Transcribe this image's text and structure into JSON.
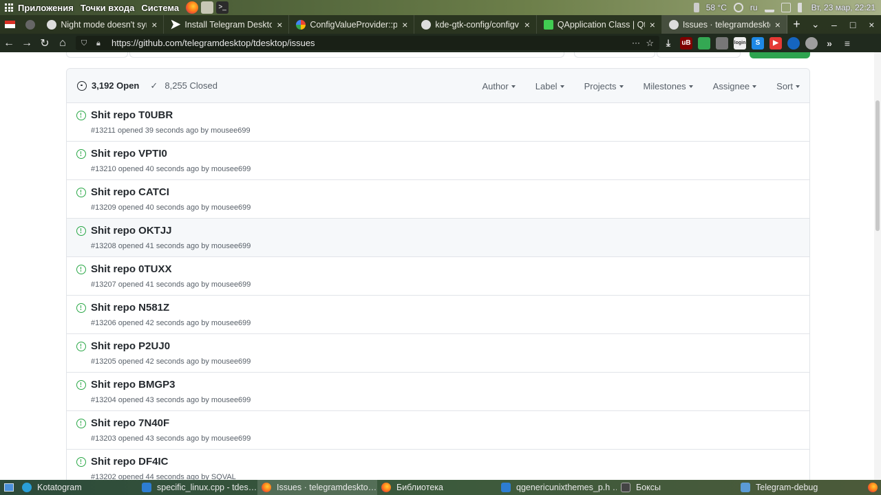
{
  "system_panel": {
    "menus": [
      "Приложения",
      "Точки входа",
      "Система"
    ],
    "temperature": "58 °C",
    "keyboard_layout": "ru",
    "clock": "Вт, 23 мар, 22:21"
  },
  "browser": {
    "tabs": [
      {
        "title": "Night mode doesn't syn",
        "icon": "github-icon"
      },
      {
        "title": "Install Telegram Deskto",
        "icon": "telegram-icon"
      },
      {
        "title": "ConfigValueProvider::p",
        "icon": "google-icon"
      },
      {
        "title": "kde-gtk-config/configv",
        "icon": "github-icon"
      },
      {
        "title": "QApplication Class | Qt",
        "icon": "qt-icon"
      },
      {
        "title": "Issues · telegramdeskto",
        "icon": "github-icon",
        "active": true
      }
    ],
    "new_tab": "+",
    "url": "https://github.com/telegramdesktop/tdesktop/issues",
    "more_actions": "···",
    "extensions": [
      {
        "name": "ublock-icon",
        "badge": "4"
      },
      {
        "name": "sheets-icon",
        "badge": "2"
      },
      {
        "name": "mask-icon",
        "badge": ""
      },
      {
        "name": "login-icon",
        "badge": "login"
      },
      {
        "name": "s-icon",
        "badge": ""
      },
      {
        "name": "youtube-icon",
        "badge": ""
      },
      {
        "name": "clock-icon",
        "badge": ""
      },
      {
        "name": "circle-icon",
        "badge": ""
      }
    ]
  },
  "issues": {
    "open_count": "3,192 Open",
    "closed_count": "8,255 Closed",
    "filters": [
      "Author",
      "Label",
      "Projects",
      "Milestones",
      "Assignee",
      "Sort"
    ],
    "items": [
      {
        "title": "Shit repo T0UBR",
        "meta": "#13211 opened 39 seconds ago by mousee699"
      },
      {
        "title": "Shit repo VPTI0",
        "meta": "#13210 opened 40 seconds ago by mousee699"
      },
      {
        "title": "Shit repo CATCI",
        "meta": "#13209 opened 40 seconds ago by mousee699"
      },
      {
        "title": "Shit repo OKTJJ",
        "meta": "#13208 opened 41 seconds ago by mousee699"
      },
      {
        "title": "Shit repo 0TUXX",
        "meta": "#13207 opened 41 seconds ago by mousee699"
      },
      {
        "title": "Shit repo N581Z",
        "meta": "#13206 opened 42 seconds ago by mousee699"
      },
      {
        "title": "Shit repo P2UJ0",
        "meta": "#13205 opened 42 seconds ago by mousee699"
      },
      {
        "title": "Shit repo BMGP3",
        "meta": "#13204 opened 43 seconds ago by mousee699"
      },
      {
        "title": "Shit repo 7N40F",
        "meta": "#13203 opened 43 seconds ago by mousee699"
      },
      {
        "title": "Shit repo DF4IC",
        "meta": "#13202 opened 44 seconds ago by SQVAL"
      }
    ]
  },
  "taskbar": {
    "tasks": [
      {
        "label": "Kotatogram",
        "icon": "telegram-icon"
      },
      {
        "label": "specific_linux.cpp - tdes…",
        "icon": "vscode-icon"
      },
      {
        "label": "Issues · telegramdeskto…",
        "icon": "firefox-icon",
        "active": true
      },
      {
        "label": "Библиотека",
        "icon": "firefox-icon"
      },
      {
        "label": "qgenericunixthemes_p.h …",
        "icon": "vscode-icon"
      },
      {
        "label": "Боксы",
        "icon": "boxes-icon"
      },
      {
        "label": "Telegram-debug",
        "icon": "folder-icon"
      }
    ]
  },
  "colors": {
    "open_green": "#28a745",
    "text_primary": "#24292e",
    "text_muted": "#586069",
    "border": "#e1e4e8"
  }
}
